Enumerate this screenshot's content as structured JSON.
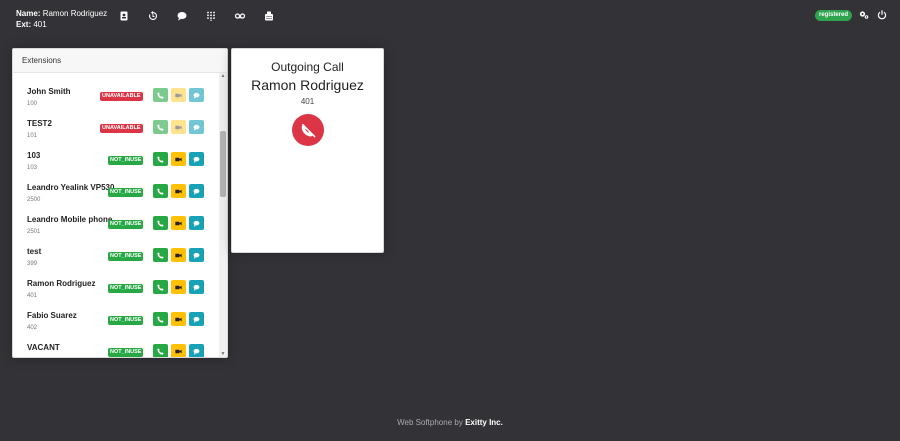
{
  "header": {
    "name_label": "Name:",
    "name_value": "Ramon Rodriguez",
    "ext_label": "Ext:",
    "ext_value": "401",
    "nav_icons": [
      "contacts-icon",
      "history-icon",
      "chat-icon",
      "dialpad-icon",
      "voicemail-icon",
      "fax-icon"
    ],
    "status": "registered",
    "right_icons": [
      "settings-icon",
      "power-icon"
    ]
  },
  "extensions": {
    "title": "Extensions",
    "items": [
      {
        "name": "John Smith",
        "number": "100",
        "status": "UNAVAILABLE"
      },
      {
        "name": "TEST2",
        "number": "101",
        "status": "UNAVAILABLE"
      },
      {
        "name": "103",
        "number": "103",
        "status": "NOT_INUSE"
      },
      {
        "name": "Leandro Yealink VP530",
        "number": "2500",
        "status": "NOT_INUSE"
      },
      {
        "name": "Leandro Mobile phone",
        "number": "2501",
        "status": "NOT_INUSE"
      },
      {
        "name": "test",
        "number": "399",
        "status": "NOT_INUSE"
      },
      {
        "name": "Ramon Rodriguez",
        "number": "401",
        "status": "NOT_INUSE"
      },
      {
        "name": "Fabio Suarez",
        "number": "402",
        "status": "NOT_INUSE"
      },
      {
        "name": "VACANT",
        "number": "",
        "status": "NOT_INUSE"
      }
    ]
  },
  "call": {
    "title": "Outgoing Call",
    "name": "Ramon Rodriguez",
    "ext": "401"
  },
  "footer": {
    "prefix": "Web Softphone by",
    "brand": "Exitty Inc."
  },
  "colors": {
    "background": "#333236",
    "registered": "#2ea44f",
    "unavailable": "#dc3545",
    "not_inuse": "#28a745",
    "call_btn": "#28a745",
    "video_btn": "#ffc107",
    "chat_btn": "#17a2b8",
    "hangup": "#dc3545"
  }
}
